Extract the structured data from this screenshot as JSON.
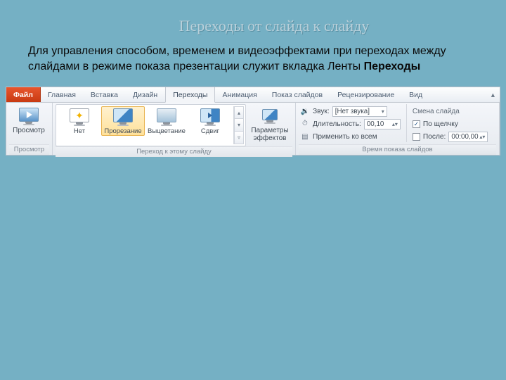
{
  "heading": "Переходы от слайда к слайду",
  "paragraph_plain": "Для управления способом, временем и видеоэффектами при переходах между слайдами в режиме показа презентации служит вкладка Ленты ",
  "paragraph_bold": "Переходы",
  "tabs": {
    "file": "Файл",
    "home": "Главная",
    "insert": "Вставка",
    "design": "Дизайн",
    "transitions": "Переходы",
    "animation": "Анимация",
    "slideshow": "Показ слайдов",
    "review": "Рецензирование",
    "view": "Вид"
  },
  "groups": {
    "preview": "Просмотр",
    "transition": "Переход к этому слайду",
    "timing": "Время показа слайдов"
  },
  "buttons": {
    "preview": "Просмотр",
    "effect_options": "Параметры\nэффектов",
    "apply_all": "Применить ко всем"
  },
  "gallery": {
    "none": "Нет",
    "cut": "Прорезание",
    "fade": "Выцветание",
    "shift": "Сдвиг"
  },
  "timing": {
    "sound_label": "Звук:",
    "sound_value": "[Нет звука]",
    "duration_label": "Длительность:",
    "duration_value": "00,10"
  },
  "advance": {
    "title": "Смена слайда",
    "onclick": "По щелчку",
    "after": "После:",
    "after_value": "00:00,00"
  }
}
